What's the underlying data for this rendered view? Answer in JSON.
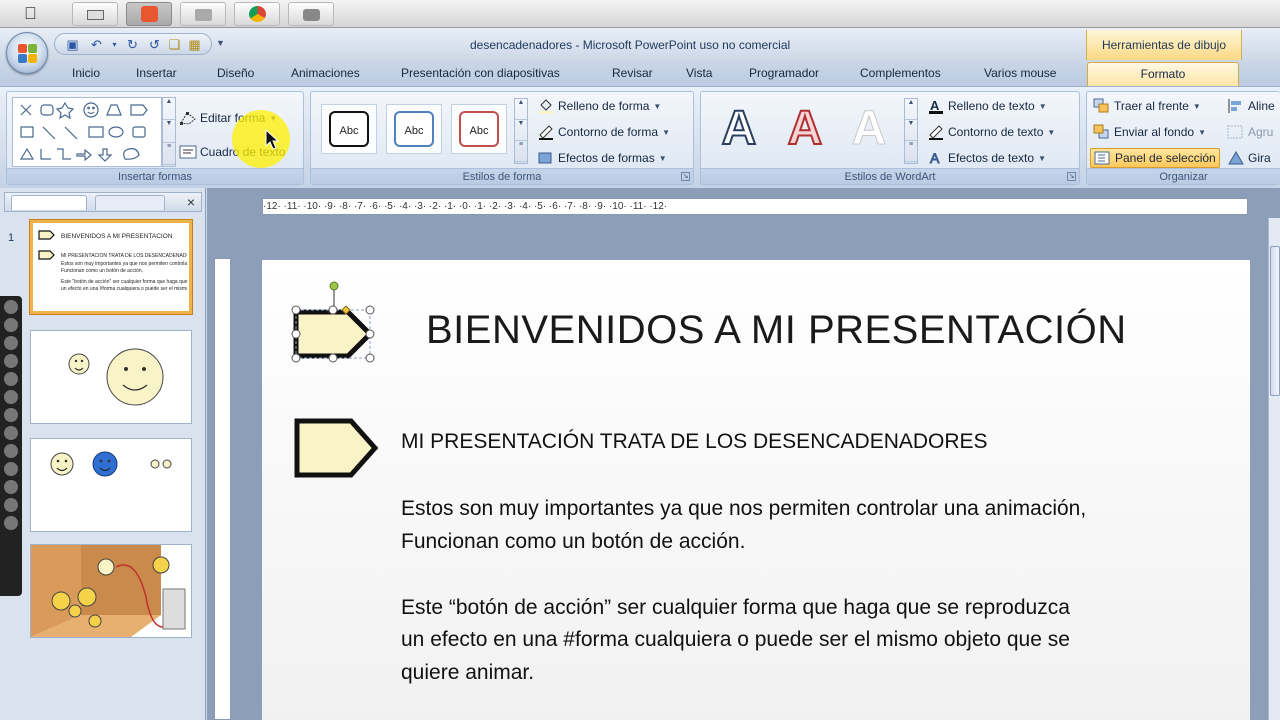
{
  "window": {
    "title": "desencadenadores - Microsoft PowerPoint uso no comercial",
    "contextual_title": "Herramientas de dibujo"
  },
  "tabs": [
    "Inicio",
    "Insertar",
    "Diseño",
    "Animaciones",
    "Presentación con diapositivas",
    "Revisar",
    "Vista",
    "Programador",
    "Complementos",
    "Varios mouse",
    "Formato"
  ],
  "ribbon": {
    "insertar_formas": {
      "label": "Insertar formas",
      "editar_forma": "Editar forma",
      "cuadro_texto": "Cuadro de texto"
    },
    "estilos_forma": {
      "label": "Estilos de forma",
      "preset_label": "Abc",
      "relleno": "Relleno de forma",
      "contorno": "Contorno de forma",
      "efectos": "Efectos de formas"
    },
    "wordart": {
      "label": "Estilos de WordArt",
      "letter": "A",
      "relleno": "Relleno de texto",
      "contorno": "Contorno de texto",
      "efectos": "Efectos de texto"
    },
    "organizar": {
      "label": "Organizar",
      "traer": "Traer al frente",
      "enviar": "Enviar al fondo",
      "panel": "Panel de selección",
      "alinear": "Aline",
      "agrupar": "Agru",
      "girar": "Gira"
    }
  },
  "slides_panel": {
    "numbers": [
      "1"
    ],
    "thumb1": {
      "title": "BIENVENIDOS A MI PRESENTACIÓN",
      "line1": "MI PRESENTACIÓN TRATA DE LOS DESENCADENADORES",
      "line2": "Estos son muy importantes ya que nos permiten controlar una animación,",
      "line3": "Funcionan como un botón de acción.",
      "line4": "Este \"botón de acción\" ser cualquier forma que haga que se reproduzca",
      "line5": "un efecto en una #forma cualquiera o puede ser el mismo objeto que se"
    }
  },
  "ruler": {
    "horizontal": "·12·  ·11·  ·10·  ·9·  ·8·  ·7·  ·6·  ·5·  ·4·  ·3·  ·2·  ·1·  ·0·  ·1·  ·2·  ·3·  ·4·  ·5·  ·6·  ·7·  ·8·  ·9·  ·10·  ·11·  ·12·"
  },
  "slide": {
    "title": "BIENVENIDOS A MI PRESENTACIÓN",
    "subheading": "MI PRESENTACIÓN TRATA DE LOS  DESENCADENADORES",
    "para1_line1": "Estos son muy importantes ya que nos permiten controlar una animación,",
    "para1_line2": "Funcionan como un botón de acción.",
    "para2_line1": "Este “botón de acción” ser cualquier forma que haga que se reproduzca",
    "para2_line2": "un efecto en una #forma cualquiera o puede ser el mismo objeto que se",
    "para2_line3": " quiere animar."
  },
  "colors": {
    "accent_tab": "#fde4a2",
    "shape_fill": "#f8f4c8",
    "selection_handle": "#9fc44a"
  }
}
